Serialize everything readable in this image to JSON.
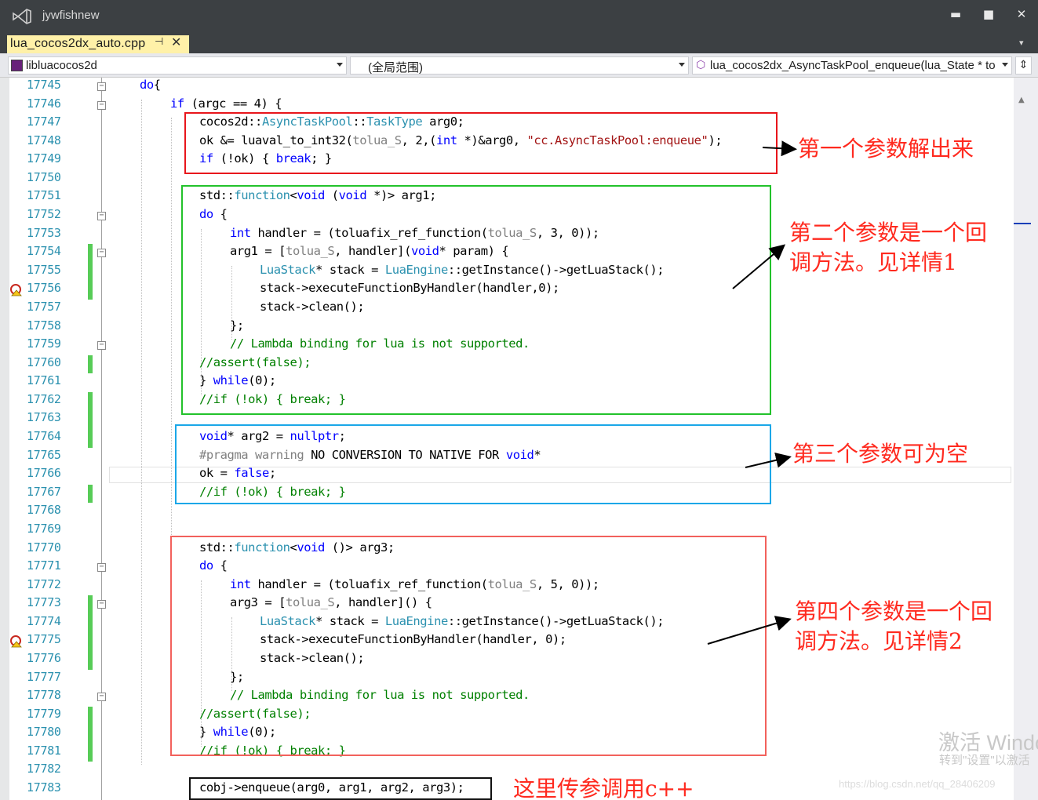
{
  "window": {
    "title": "jywfishnew",
    "minimize": "▬",
    "maximize": "■",
    "close": "✕"
  },
  "tab": {
    "label": "lua_cocos2dx_auto.cpp",
    "pin": "⊣",
    "close": "✕",
    "overflow": "▾"
  },
  "nav": {
    "project": "libluacocos2d",
    "scope": "(全局范围)",
    "member": "lua_cocos2dx_AsyncTaskPool_enqueue(lua_State * to",
    "split_icon": "split-icon"
  },
  "line_numbers": [
    "17745",
    "17746",
    "17747",
    "17748",
    "17749",
    "17750",
    "17751",
    "17752",
    "17753",
    "17754",
    "17755",
    "17756",
    "17757",
    "17758",
    "17759",
    "17760",
    "17761",
    "17762",
    "17763",
    "17764",
    "17765",
    "17766",
    "17767",
    "17768",
    "17769",
    "17770",
    "17771",
    "17772",
    "17773",
    "17774",
    "17775",
    "17776",
    "17777",
    "17778",
    "17779",
    "17780",
    "17781",
    "17782",
    "17783"
  ],
  "code": [
    {
      "line": "17745",
      "segments": [
        {
          "t": "do",
          "c": "kw"
        },
        {
          "t": "{",
          "c": ""
        }
      ]
    },
    {
      "line": "17746",
      "segments": [
        {
          "t": "if",
          "c": "kw"
        },
        {
          "t": " (argc == 4) {",
          "c": ""
        }
      ]
    },
    {
      "line": "17747",
      "segments": [
        {
          "t": "cocos2d::",
          "c": ""
        },
        {
          "t": "AsyncTaskPool",
          "c": "ty"
        },
        {
          "t": "::",
          "c": ""
        },
        {
          "t": "TaskType",
          "c": "ty"
        },
        {
          "t": " arg0;",
          "c": ""
        }
      ]
    },
    {
      "line": "17748",
      "segments": [
        {
          "t": "ok &= luaval_to_int32(",
          "c": ""
        },
        {
          "t": "tolua_S",
          "c": "pp"
        },
        {
          "t": ", 2,(",
          "c": ""
        },
        {
          "t": "int",
          "c": "kw"
        },
        {
          "t": " *)&arg0, ",
          "c": ""
        },
        {
          "t": "\"cc.AsyncTaskPool:enqueue\"",
          "c": "st"
        },
        {
          "t": ");",
          "c": ""
        }
      ]
    },
    {
      "line": "17749",
      "segments": [
        {
          "t": "if",
          "c": "kw"
        },
        {
          "t": " (!ok) { ",
          "c": ""
        },
        {
          "t": "break",
          "c": "kw"
        },
        {
          "t": "; }",
          "c": ""
        }
      ]
    },
    {
      "line": "17750",
      "segments": []
    },
    {
      "line": "17751",
      "segments": [
        {
          "t": "std::",
          "c": ""
        },
        {
          "t": "function",
          "c": "ty"
        },
        {
          "t": "<",
          "c": ""
        },
        {
          "t": "void",
          "c": "kw"
        },
        {
          "t": " (",
          "c": ""
        },
        {
          "t": "void",
          "c": "kw"
        },
        {
          "t": " *)> arg1;",
          "c": ""
        }
      ]
    },
    {
      "line": "17752",
      "segments": [
        {
          "t": "do",
          "c": "kw"
        },
        {
          "t": " {",
          "c": ""
        }
      ]
    },
    {
      "line": "17753",
      "segments": [
        {
          "t": "int",
          "c": "kw"
        },
        {
          "t": " handler = (toluafix_ref_function(",
          "c": ""
        },
        {
          "t": "tolua_S",
          "c": "pp"
        },
        {
          "t": ", 3, 0));",
          "c": ""
        }
      ]
    },
    {
      "line": "17754",
      "segments": [
        {
          "t": "arg1 = [",
          "c": ""
        },
        {
          "t": "tolua_S",
          "c": "pp"
        },
        {
          "t": ", handler](",
          "c": ""
        },
        {
          "t": "void",
          "c": "kw"
        },
        {
          "t": "* param) {",
          "c": ""
        }
      ]
    },
    {
      "line": "17755",
      "segments": [
        {
          "t": "LuaStack",
          "c": "ty"
        },
        {
          "t": "* stack = ",
          "c": ""
        },
        {
          "t": "LuaEngine",
          "c": "ty"
        },
        {
          "t": "::getInstance()->getLuaStack();",
          "c": ""
        }
      ]
    },
    {
      "line": "17756",
      "segments": [
        {
          "t": "stack->executeFunctionByHandler(handler,0);",
          "c": ""
        }
      ]
    },
    {
      "line": "17757",
      "segments": [
        {
          "t": "stack->clean();",
          "c": ""
        }
      ]
    },
    {
      "line": "17758",
      "segments": [
        {
          "t": "};",
          "c": ""
        }
      ]
    },
    {
      "line": "17759",
      "segments": [
        {
          "t": "// Lambda binding for lua is not supported.",
          "c": "cm"
        }
      ]
    },
    {
      "line": "17760",
      "segments": [
        {
          "t": "//assert(false);",
          "c": "cm"
        }
      ]
    },
    {
      "line": "17761",
      "segments": [
        {
          "t": "} ",
          "c": ""
        },
        {
          "t": "while",
          "c": "kw"
        },
        {
          "t": "(0);",
          "c": ""
        }
      ]
    },
    {
      "line": "17762",
      "segments": [
        {
          "t": "//if (!ok) { break; }",
          "c": "cm"
        }
      ]
    },
    {
      "line": "17763",
      "segments": []
    },
    {
      "line": "17764",
      "segments": [
        {
          "t": "void",
          "c": "kw"
        },
        {
          "t": "* arg2 = ",
          "c": ""
        },
        {
          "t": "nullptr",
          "c": "kw"
        },
        {
          "t": ";",
          "c": ""
        }
      ]
    },
    {
      "line": "17765",
      "segments": [
        {
          "t": "#pragma warning",
          "c": "pp"
        },
        {
          "t": " NO CONVERSION TO NATIVE FOR ",
          "c": ""
        },
        {
          "t": "void",
          "c": "kw"
        },
        {
          "t": "*",
          "c": ""
        }
      ]
    },
    {
      "line": "17766",
      "segments": [
        {
          "t": "ok = ",
          "c": ""
        },
        {
          "t": "false",
          "c": "kw"
        },
        {
          "t": ";",
          "c": ""
        }
      ]
    },
    {
      "line": "17767",
      "segments": [
        {
          "t": "//if (!ok) { break; }",
          "c": "cm"
        }
      ]
    },
    {
      "line": "17768",
      "segments": []
    },
    {
      "line": "17769",
      "segments": []
    },
    {
      "line": "17770",
      "segments": [
        {
          "t": "std::",
          "c": ""
        },
        {
          "t": "function",
          "c": "ty"
        },
        {
          "t": "<",
          "c": ""
        },
        {
          "t": "void",
          "c": "kw"
        },
        {
          "t": " ()> arg3;",
          "c": ""
        }
      ]
    },
    {
      "line": "17771",
      "segments": [
        {
          "t": "do",
          "c": "kw"
        },
        {
          "t": " {",
          "c": ""
        }
      ]
    },
    {
      "line": "17772",
      "segments": [
        {
          "t": "int",
          "c": "kw"
        },
        {
          "t": " handler = (toluafix_ref_function(",
          "c": ""
        },
        {
          "t": "tolua_S",
          "c": "pp"
        },
        {
          "t": ", 5, 0));",
          "c": ""
        }
      ]
    },
    {
      "line": "17773",
      "segments": [
        {
          "t": "arg3 = [",
          "c": ""
        },
        {
          "t": "tolua_S",
          "c": "pp"
        },
        {
          "t": ", handler]() {",
          "c": ""
        }
      ]
    },
    {
      "line": "17774",
      "segments": [
        {
          "t": "LuaStack",
          "c": "ty"
        },
        {
          "t": "* stack = ",
          "c": ""
        },
        {
          "t": "LuaEngine",
          "c": "ty"
        },
        {
          "t": "::getInstance()->getLuaStack();",
          "c": ""
        }
      ]
    },
    {
      "line": "17775",
      "segments": [
        {
          "t": "stack->executeFunctionByHandler(handler, 0);",
          "c": ""
        }
      ]
    },
    {
      "line": "17776",
      "segments": [
        {
          "t": "stack->clean();",
          "c": ""
        }
      ]
    },
    {
      "line": "17777",
      "segments": [
        {
          "t": "};",
          "c": ""
        }
      ]
    },
    {
      "line": "17778",
      "segments": [
        {
          "t": "// Lambda binding for lua is not supported.",
          "c": "cm"
        }
      ]
    },
    {
      "line": "17779",
      "segments": [
        {
          "t": "//assert(false);",
          "c": "cm"
        }
      ]
    },
    {
      "line": "17780",
      "segments": [
        {
          "t": "} ",
          "c": ""
        },
        {
          "t": "while",
          "c": "kw"
        },
        {
          "t": "(0);",
          "c": ""
        }
      ]
    },
    {
      "line": "17781",
      "segments": [
        {
          "t": "//if (!ok) { break; }",
          "c": "cm"
        }
      ]
    },
    {
      "line": "17782",
      "segments": []
    },
    {
      "line": "17783",
      "segments": [
        {
          "t": "cobj->enqueue(arg0, arg1, arg2, arg3);",
          "c": ""
        }
      ]
    }
  ],
  "annotations": {
    "note1": "第一个参数解出来",
    "note2": "第二个参数是一个回\n调方法。见详情1",
    "note3": "第三个参数可为空",
    "note4": "第四个参数是一个回\n调方法。见详情2",
    "note5": "这里传参调用c++"
  },
  "annotation_colors": {
    "red": "#e8151b",
    "green": "#22c22b",
    "blue": "#1aa7e8",
    "salmon": "#f2615c",
    "black": "#111111",
    "text": "#ff2a1f"
  },
  "watermark": {
    "line1": "激活 Windo",
    "line2": "转到\"设置\"以激活",
    "line3": "https://blog.csdn.net/qq_28406209"
  }
}
